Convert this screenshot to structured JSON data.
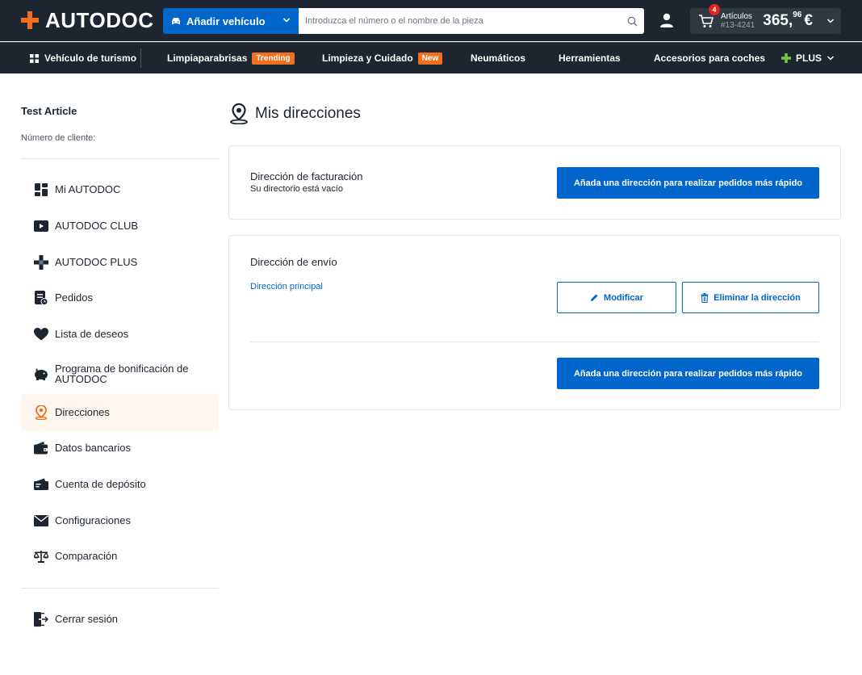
{
  "header": {
    "logo": "AUTODOC",
    "add_vehicle_label": "Añadir vehículo",
    "search_placeholder": "Introduzca el número o el nombre de la pieza",
    "cart": {
      "count": "4",
      "label": "Artículos",
      "code": "#13-4241",
      "total_main": "365,",
      "total_cents": "96",
      "currency": "€"
    }
  },
  "nav": {
    "items": [
      {
        "label": "Vehículo de turismo"
      },
      {
        "label": "Limpiaparabrisas",
        "badge": "Trending"
      },
      {
        "label": "Limpieza y Cuidado",
        "badge": "New"
      },
      {
        "label": "Neumáticos"
      },
      {
        "label": "Herramientas"
      },
      {
        "label": "Accesorios para coches"
      },
      {
        "label": "PLUS"
      }
    ]
  },
  "sidebar": {
    "user_name": "Test Article",
    "client_number_label": "Número de cliente:",
    "items": [
      {
        "label": "Mi AUTODOC",
        "icon": "dashboard-icon"
      },
      {
        "label": "AUTODOC CLUB",
        "icon": "play-icon"
      },
      {
        "label": "AUTODOC PLUS",
        "icon": "plus-icon"
      },
      {
        "label": "Pedidos",
        "icon": "orders-icon"
      },
      {
        "label": "Lista de deseos",
        "icon": "heart-icon"
      },
      {
        "label": "Programa de bonificación de AUTODOC",
        "icon": "piggy-bank-icon"
      },
      {
        "label": "Direcciones",
        "icon": "location-pin-icon",
        "active": true
      },
      {
        "label": "Datos bancarios",
        "icon": "wallet-icon"
      },
      {
        "label": "Cuenta de depósito",
        "icon": "deposit-icon"
      },
      {
        "label": "Configuraciones",
        "icon": "envelope-icon"
      },
      {
        "label": "Comparación",
        "icon": "scales-icon"
      }
    ],
    "logout_label": "Cerrar sesión"
  },
  "main": {
    "title": "Mis direcciones",
    "billing": {
      "title": "Dirección de facturación",
      "subtitle": "Su directorio está vacío",
      "add_button": "Añada una dirección para realizar pedidos más rápido"
    },
    "shipping": {
      "title": "Dirección de envío",
      "primary_link": "Dirección principal",
      "edit_button": "Modificar",
      "delete_button": "Eliminar la dirección",
      "add_button": "Añada una dirección para realizar pedidos más rápido"
    }
  },
  "colors": {
    "header_bg": "#1c2530",
    "brand_orange": "#f26f1e",
    "primary_blue": "#0066cc"
  }
}
